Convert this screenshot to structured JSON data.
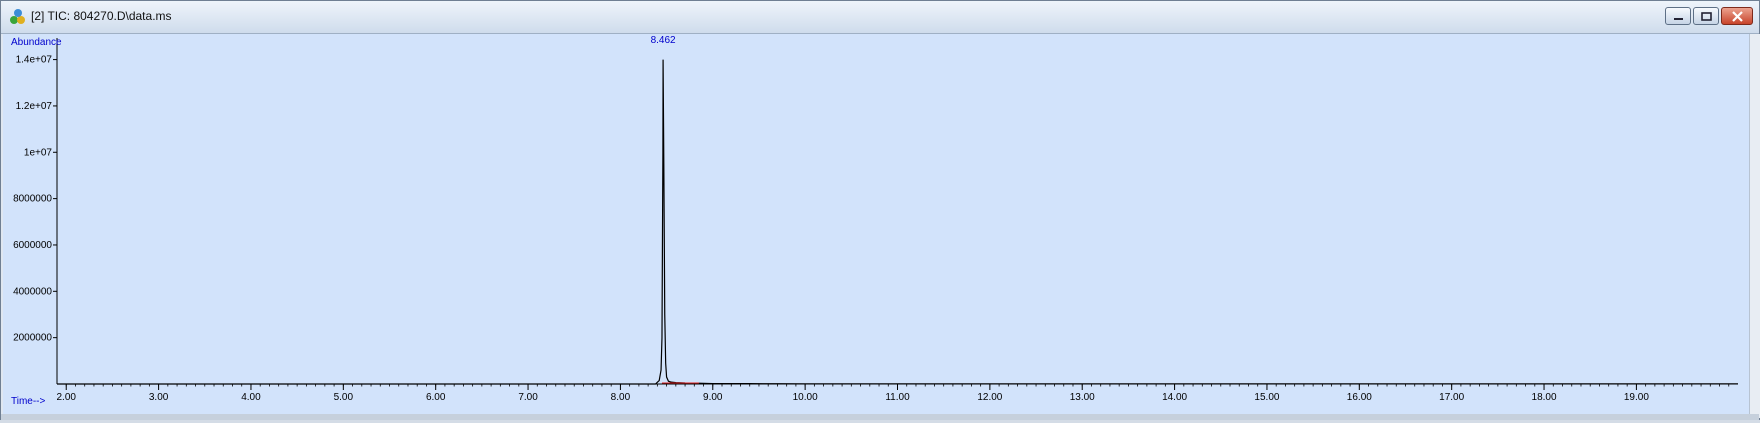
{
  "window": {
    "title": "[2] TIC: 804270.D\\data.ms",
    "controls": {
      "minimize": "minimize",
      "restore": "restore",
      "close": "close"
    }
  },
  "chart_data": {
    "type": "line",
    "ylabel": "Abundance",
    "xlabel": "Time-->",
    "xlim": [
      1.9,
      20.1
    ],
    "ylim": [
      0,
      14500000
    ],
    "x_ticks": [
      "2.00",
      "3.00",
      "4.00",
      "5.00",
      "6.00",
      "7.00",
      "8.00",
      "9.00",
      "10.00",
      "11.00",
      "12.00",
      "13.00",
      "14.00",
      "15.00",
      "16.00",
      "17.00",
      "18.00",
      "19.00"
    ],
    "x_tick_values": [
      2,
      3,
      4,
      5,
      6,
      7,
      8,
      9,
      10,
      11,
      12,
      13,
      14,
      15,
      16,
      17,
      18,
      19
    ],
    "y_ticks": [
      "2000000",
      "4000000",
      "6000000",
      "8000000",
      "1e+07",
      "1.2e+07",
      "1.4e+07"
    ],
    "y_tick_values": [
      2000000,
      4000000,
      6000000,
      8000000,
      10000000,
      12000000,
      14000000
    ],
    "peak_label": "8.462",
    "series": [
      {
        "x": [
          1.9,
          8.38,
          8.42,
          8.44,
          8.45,
          8.46,
          8.462,
          8.47,
          8.48,
          8.49,
          8.5,
          8.52,
          8.55,
          8.6,
          8.7,
          8.8,
          8.9,
          9.0,
          9.4,
          9.7,
          10.0,
          20.1
        ],
        "y": [
          0,
          0,
          150000,
          600000,
          2000000,
          10000000,
          14000000,
          9500000,
          3000000,
          900000,
          300000,
          120000,
          80000,
          60000,
          45000,
          40000,
          30000,
          20000,
          15000,
          12000,
          8000,
          5000
        ]
      }
    ],
    "baseline_segment": {
      "x": [
        8.45,
        8.85
      ],
      "y": [
        0,
        0
      ]
    },
    "colors": {
      "trace": "#000000",
      "baseline": "#e02020",
      "axis_label": "#0000cc",
      "background": "#d2e3fb"
    }
  }
}
